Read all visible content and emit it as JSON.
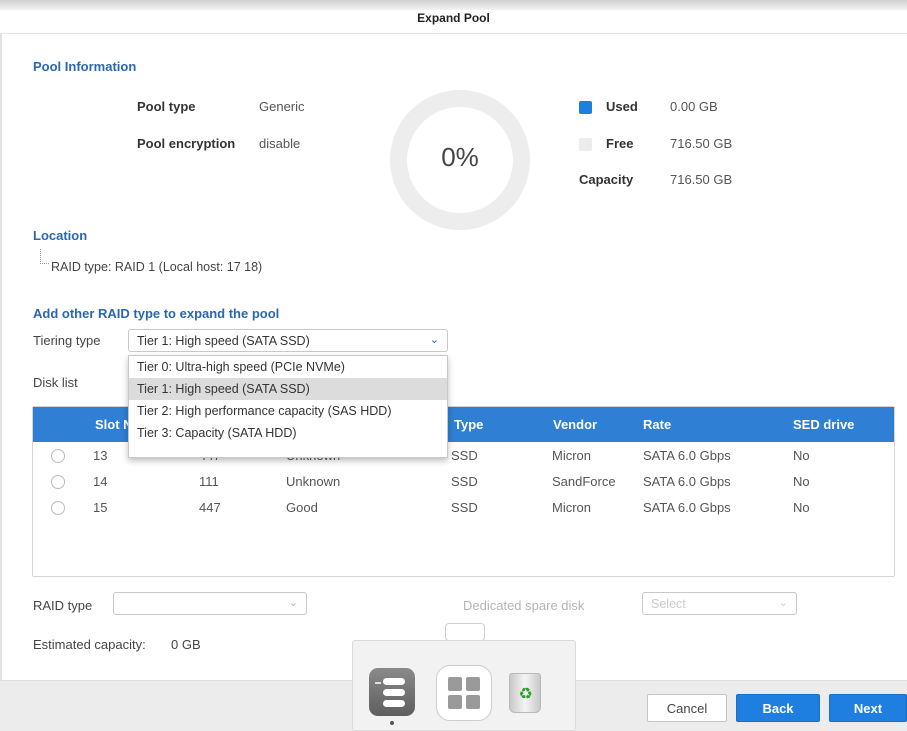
{
  "window": {
    "title": "Expand Pool"
  },
  "pool_info": {
    "heading": "Pool Information",
    "pool_type_label": "Pool type",
    "pool_type_value": "Generic",
    "encryption_label": "Pool encryption",
    "encryption_value": "disable",
    "usage_percent_text": "0%",
    "used_label": "Used",
    "used_value": "0.00 GB",
    "free_label": "Free",
    "free_value": "716.50 GB",
    "capacity_label": "Capacity",
    "capacity_value": "716.50 GB",
    "colors": {
      "used": "#1e7fe0",
      "free": "#ececec",
      "ring": "#ededed"
    }
  },
  "location": {
    "heading": "Location",
    "tree_item": "RAID type: RAID 1 (Local host: 17 18)"
  },
  "expand": {
    "heading": "Add other RAID type to expand the pool",
    "tiering_label": "Tiering type",
    "tiering_selected": "Tier 1: High speed (SATA SSD)",
    "tiering_options": [
      "Tier 0: Ultra-high speed (PCIe NVMe)",
      "Tier 1: High speed (SATA SSD)",
      "Tier 2: High performance capacity (SAS HDD)",
      "Tier 3: Capacity (SATA HDD)"
    ],
    "disk_list_label": "Disk list"
  },
  "table": {
    "headers": [
      "Slot N",
      "Type",
      "Vendor",
      "Rate",
      "SED drive"
    ],
    "rows": [
      {
        "slot": "13",
        "size": "447",
        "status": "Unknown",
        "type": "SSD",
        "vendor": "Micron",
        "rate": "SATA 6.0 Gbps",
        "sed": "No"
      },
      {
        "slot": "14",
        "size": "111",
        "status": "Unknown",
        "type": "SSD",
        "vendor": "SandForce",
        "rate": "SATA 6.0 Gbps",
        "sed": "No"
      },
      {
        "slot": "15",
        "size": "447",
        "status": "Good",
        "type": "SSD",
        "vendor": "Micron",
        "rate": "SATA 6.0 Gbps",
        "sed": "No"
      }
    ]
  },
  "raid": {
    "raid_type_label": "RAID type",
    "raid_type_value": "",
    "spare_label": "Dedicated spare disk",
    "spare_placeholder": "Select",
    "estimated_label": "Estimated capacity:",
    "estimated_value": "0 GB"
  },
  "footer": {
    "cancel": "Cancel",
    "back": "Back",
    "next": "Next"
  },
  "dock": {
    "icons": [
      "storage-app-icon",
      "main-menu-icon",
      "recycle-bin-icon"
    ]
  }
}
